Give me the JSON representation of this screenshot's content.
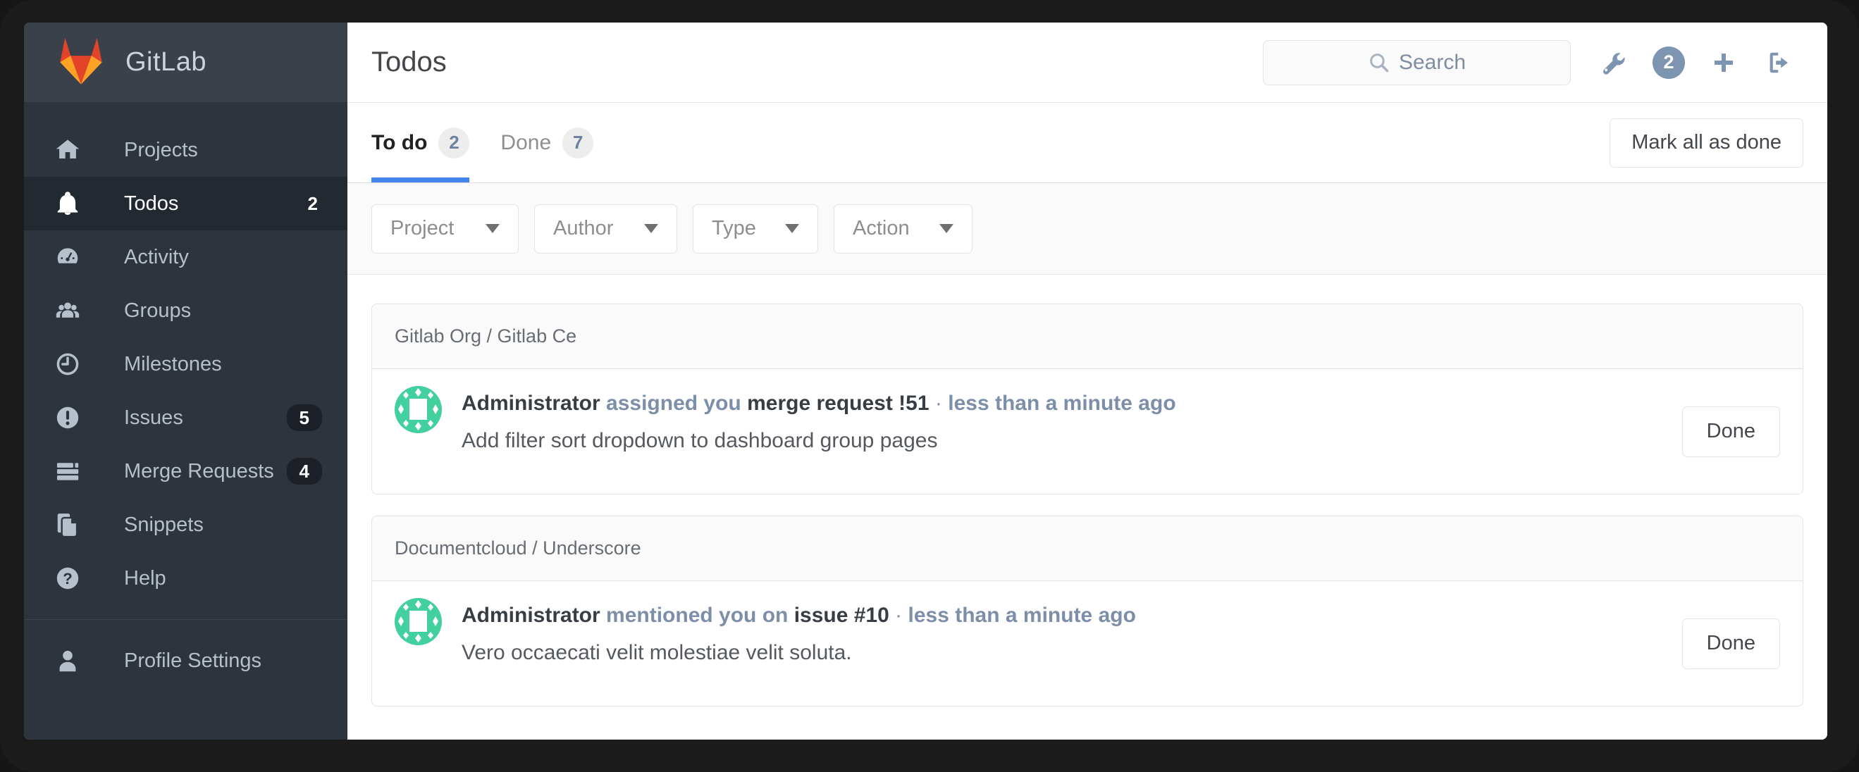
{
  "app": {
    "brand": "GitLab"
  },
  "colors": {
    "logo_dark_orange": "#e24329",
    "logo_orange": "#fc6d26",
    "logo_light_orange": "#fca326",
    "accent_blue": "#4285ee",
    "header_icon_slate": "#7e95b1",
    "avatar_green": "#41d09e"
  },
  "sidebar": {
    "items": [
      {
        "label": "Projects",
        "icon": "home-icon",
        "badge": ""
      },
      {
        "label": "Todos",
        "icon": "bell-icon",
        "badge": "2"
      },
      {
        "label": "Activity",
        "icon": "gauge-icon",
        "badge": ""
      },
      {
        "label": "Groups",
        "icon": "users-icon",
        "badge": ""
      },
      {
        "label": "Milestones",
        "icon": "clock-icon",
        "badge": ""
      },
      {
        "label": "Issues",
        "icon": "exclamation-circle-icon",
        "badge": "5"
      },
      {
        "label": "Merge Requests",
        "icon": "list-icon",
        "badge": "4"
      },
      {
        "label": "Snippets",
        "icon": "snippet-icon",
        "badge": ""
      },
      {
        "label": "Help",
        "icon": "question-circle-icon",
        "badge": ""
      }
    ],
    "footer_item": {
      "label": "Profile Settings",
      "icon": "user-icon"
    }
  },
  "header": {
    "title": "Todos",
    "search_placeholder": "Search",
    "todo_count": "2"
  },
  "tabs": [
    {
      "label": "To do",
      "count": "2"
    },
    {
      "label": "Done",
      "count": "7"
    }
  ],
  "toolbar": {
    "mark_all_label": "Mark all as done"
  },
  "filters": [
    {
      "label": "Project"
    },
    {
      "label": "Author"
    },
    {
      "label": "Type"
    },
    {
      "label": "Action"
    }
  ],
  "groups": [
    {
      "project": "Gitlab Org / Gitlab Ce",
      "todo": {
        "author": "Administrator",
        "action": "assigned you",
        "target": "merge request !51",
        "sep": "·",
        "time": "less than a minute ago",
        "body": "Add filter sort dropdown to dashboard group pages",
        "done_label": "Done"
      }
    },
    {
      "project": "Documentcloud / Underscore",
      "todo": {
        "author": "Administrator",
        "action": "mentioned you on",
        "target": "issue #10",
        "sep": "·",
        "time": "less than a minute ago",
        "body": "Vero occaecati velit molestiae velit soluta.",
        "done_label": "Done"
      }
    }
  ]
}
